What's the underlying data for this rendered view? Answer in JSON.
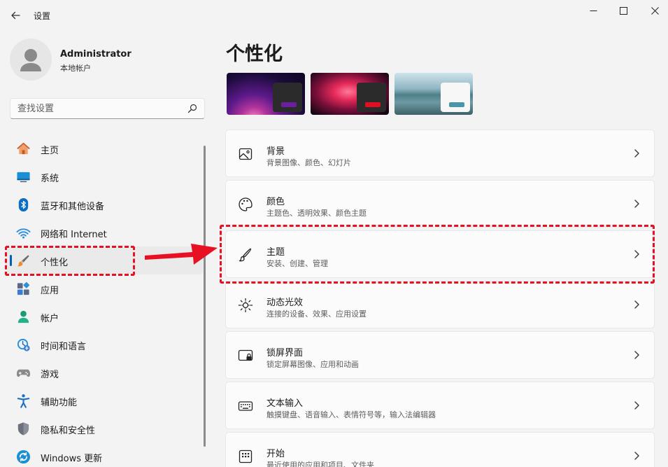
{
  "window": {
    "title": "设置",
    "back_icon": "back-arrow-icon",
    "controls": [
      "minimize-icon",
      "maximize-icon",
      "close-icon"
    ]
  },
  "profile": {
    "name": "Administrator",
    "account_type": "本地帐户"
  },
  "search": {
    "placeholder": "查找设置"
  },
  "sidebar": {
    "items": [
      {
        "label": "主页",
        "icon": "home-icon"
      },
      {
        "label": "系统",
        "icon": "system-icon"
      },
      {
        "label": "蓝牙和其他设备",
        "icon": "bluetooth-icon"
      },
      {
        "label": "网络和 Internet",
        "icon": "wifi-icon"
      },
      {
        "label": "个性化",
        "icon": "brush-icon",
        "active": true
      },
      {
        "label": "应用",
        "icon": "apps-icon"
      },
      {
        "label": "帐户",
        "icon": "account-icon"
      },
      {
        "label": "时间和语言",
        "icon": "time-language-icon"
      },
      {
        "label": "游戏",
        "icon": "gamepad-icon"
      },
      {
        "label": "辅助功能",
        "icon": "accessibility-icon"
      },
      {
        "label": "隐私和安全性",
        "icon": "shield-icon"
      },
      {
        "label": "Windows 更新",
        "icon": "windows-update-icon"
      }
    ]
  },
  "main": {
    "title": "个性化",
    "themes": [
      {
        "name": "theme-1",
        "accent": "#6b1fa0"
      },
      {
        "name": "theme-2",
        "accent": "#e01020"
      },
      {
        "name": "theme-3",
        "accent": "#4a95a8"
      }
    ],
    "cards": [
      {
        "title": "背景",
        "desc": "背景图像、颜色、幻灯片",
        "icon": "image-icon"
      },
      {
        "title": "颜色",
        "desc": "主题色、透明效果、颜色主题",
        "icon": "palette-icon"
      },
      {
        "title": "主题",
        "desc": "安装、创建、管理",
        "icon": "brush-icon"
      },
      {
        "title": "动态光效",
        "desc": "连接的设备、效果、应用设置",
        "icon": "dynamic-lighting-icon"
      },
      {
        "title": "锁屏界面",
        "desc": "锁定屏幕图像、应用和动画",
        "icon": "lock-screen-icon"
      },
      {
        "title": "文本输入",
        "desc": "触摸键盘、语音输入、表情符号等，输入法编辑器",
        "icon": "keyboard-icon"
      },
      {
        "title": "开始",
        "desc": "最近使用的应用和项目、文件夹",
        "icon": "start-icon"
      }
    ]
  },
  "annotation": {
    "color": "#e81123"
  }
}
